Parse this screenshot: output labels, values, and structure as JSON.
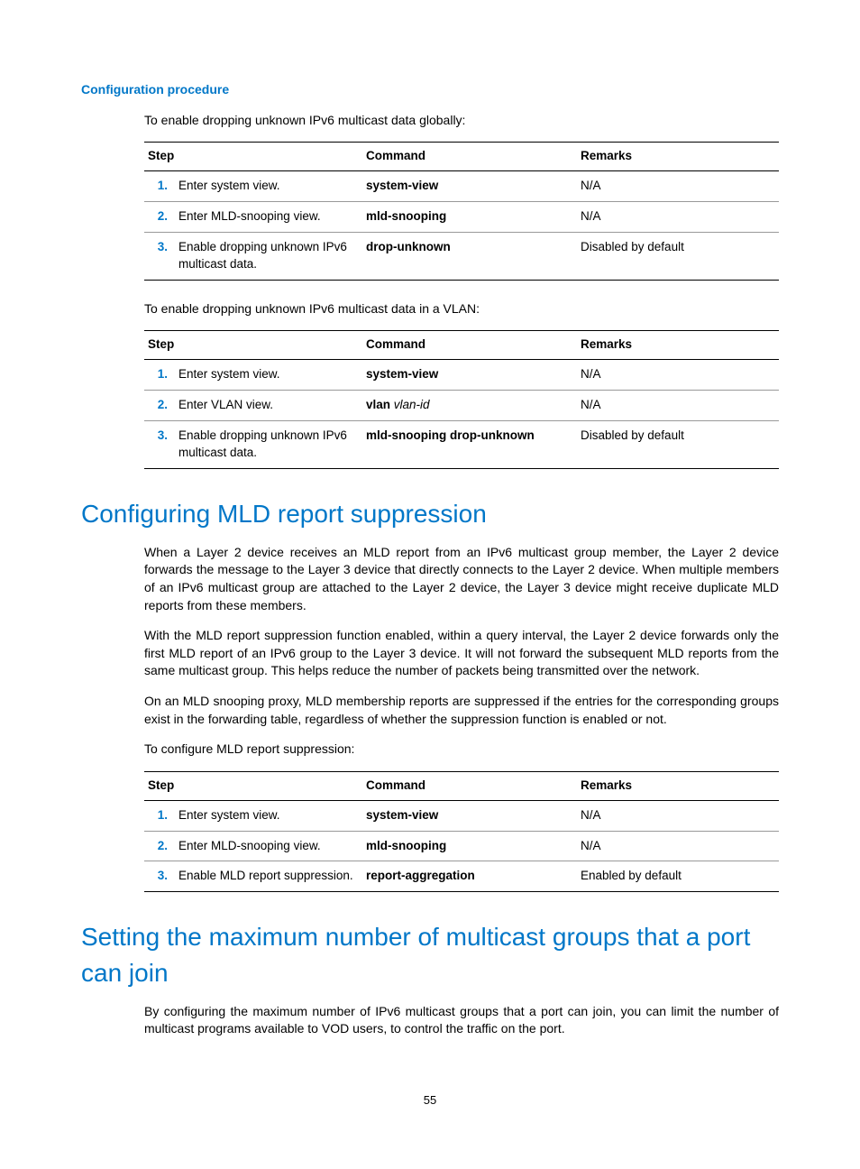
{
  "sub1": "Configuration procedure",
  "intro1": "To enable dropping unknown IPv6 multicast data globally:",
  "table_headers": {
    "step": "Step",
    "command": "Command",
    "remarks": "Remarks"
  },
  "table1": [
    {
      "n": "1.",
      "step": "Enter system view.",
      "cmd": "system-view",
      "rem": "N/A"
    },
    {
      "n": "2.",
      "step": "Enter MLD-snooping view.",
      "cmd": "mld-snooping",
      "rem": "N/A"
    },
    {
      "n": "3.",
      "step": "Enable dropping unknown IPv6 multicast data.",
      "cmd": "drop-unknown",
      "rem": "Disabled by default"
    }
  ],
  "intro2": "To enable dropping unknown IPv6 multicast data in a VLAN:",
  "table2": [
    {
      "n": "1.",
      "step": "Enter system view.",
      "cmd": "system-view",
      "rem": "N/A"
    },
    {
      "n": "2.",
      "step": "Enter VLAN view.",
      "cmd_bold": "vlan",
      "cmd_italic": "vlan-id",
      "rem": "N/A"
    },
    {
      "n": "3.",
      "step": "Enable dropping unknown IPv6 multicast data.",
      "cmd": "mld-snooping drop-unknown",
      "rem": "Disabled by default"
    }
  ],
  "h1a": "Configuring MLD report suppression",
  "para_a1": "When a Layer 2 device receives an MLD report from an IPv6 multicast group member, the Layer 2 device forwards the message to the Layer 3 device that directly connects to the Layer 2 device. When multiple members of an IPv6 multicast group are attached to the Layer 2 device, the Layer 3 device might receive duplicate MLD reports from these members.",
  "para_a2": "With the MLD report suppression function enabled, within a query interval, the Layer 2 device forwards only the first MLD report of an IPv6 group to the Layer 3 device. It will not forward the subsequent MLD reports from the same multicast group. This helps reduce the number of packets being transmitted over the network.",
  "para_a3": "On an MLD snooping proxy, MLD membership reports are suppressed if the entries for the corresponding groups exist in the forwarding table, regardless of whether the suppression function is enabled or not.",
  "para_a4": "To configure MLD report suppression:",
  "table3": [
    {
      "n": "1.",
      "step": "Enter system view.",
      "cmd": "system-view",
      "rem": "N/A"
    },
    {
      "n": "2.",
      "step": "Enter MLD-snooping view.",
      "cmd": "mld-snooping",
      "rem": "N/A"
    },
    {
      "n": "3.",
      "step": "Enable MLD report suppression.",
      "cmd": "report-aggregation",
      "rem": "Enabled by default"
    }
  ],
  "h1b": "Setting the maximum number of multicast groups that a port can join",
  "para_b1": "By configuring the maximum number of IPv6 multicast groups that a port can join, you can limit the number of multicast programs available to VOD users, to control the traffic on the port.",
  "page_number": "55"
}
